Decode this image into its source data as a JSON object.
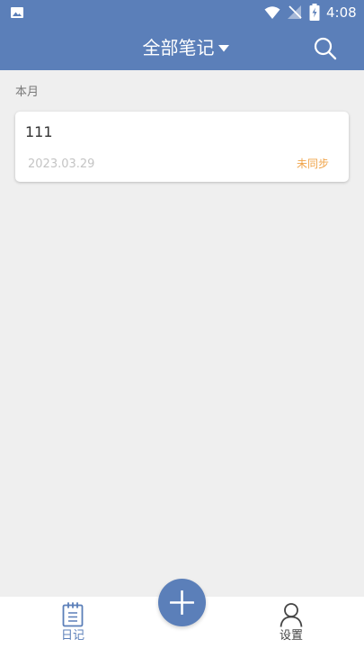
{
  "colors": {
    "primary": "#5b7fb9",
    "background": "#efefef",
    "sync_status": "#f0a44a"
  },
  "status_bar": {
    "time": "4:08",
    "icons": [
      "gallery-icon",
      "wifi-icon",
      "signal-off-icon",
      "battery-charging-icon"
    ]
  },
  "app_bar": {
    "title": "全部笔记",
    "dropdown_icon": "caret-down-icon",
    "search_icon": "search-icon"
  },
  "section": {
    "label": "本月"
  },
  "notes": [
    {
      "title": "111",
      "date": "2023.03.29",
      "sync_status": "未同步"
    }
  ],
  "fab": {
    "icon": "plus-icon"
  },
  "bottom_nav": {
    "items": [
      {
        "label": "日记",
        "icon": "notebook-icon",
        "active": true
      },
      {
        "label": "设置",
        "icon": "person-icon",
        "active": false
      }
    ]
  }
}
